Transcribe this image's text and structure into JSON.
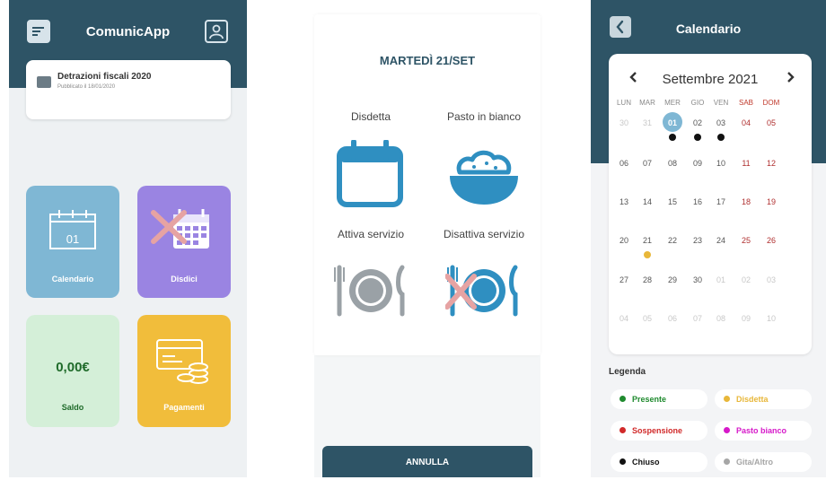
{
  "panel1": {
    "app_title": "ComunicApp",
    "news": {
      "title": "Detrazioni fiscali 2020",
      "subtitle": "Pubblicato il 18/01/2020"
    },
    "tiles": {
      "calendario": {
        "label": "Calendario",
        "day": "01"
      },
      "disdici": {
        "label": "Disdici"
      },
      "saldo": {
        "label": "Saldo",
        "amount": "0,00€"
      },
      "pagamenti": {
        "label": "Pagamenti"
      }
    },
    "colors": {
      "header": "#2e5466",
      "calendario": "#7fb7d4",
      "disdici": "#9a84e2",
      "saldo": "#d4efd8",
      "pagamenti": "#f1bd3b"
    }
  },
  "panel2": {
    "date_title": "MARTEDÌ 21/SET",
    "options": [
      {
        "label": "Disdetta",
        "icon": "calendar-icon"
      },
      {
        "label": "Pasto in bianco",
        "icon": "rice-bowl-icon"
      },
      {
        "label": "Attiva servizio",
        "icon": "plate-cutlery-icon"
      },
      {
        "label": "Disattiva servizio",
        "icon": "plate-cutlery-crossed-icon"
      }
    ],
    "cancel_label": "ANNULLA"
  },
  "panel3": {
    "title": "Calendario",
    "month": "Settembre 2021",
    "weekdays": [
      "LUN",
      "MAR",
      "MER",
      "GIO",
      "VEN",
      "SAB",
      "DOM"
    ],
    "weeks": [
      [
        "30",
        "31",
        "01",
        "02",
        "03",
        "04",
        "05"
      ],
      [
        "06",
        "07",
        "08",
        "09",
        "10",
        "11",
        "12"
      ],
      [
        "13",
        "14",
        "15",
        "16",
        "17",
        "18",
        "19"
      ],
      [
        "20",
        "21",
        "22",
        "23",
        "24",
        "25",
        "26"
      ],
      [
        "27",
        "28",
        "29",
        "30",
        "01",
        "02",
        "03"
      ],
      [
        "04",
        "05",
        "06",
        "07",
        "08",
        "09",
        "10"
      ]
    ],
    "selected_day": "01",
    "legend_title": "Legenda",
    "legend": [
      {
        "label": "Presente",
        "color": "#1f8a2e"
      },
      {
        "label": "Disdetta",
        "color": "#e8b73a"
      },
      {
        "label": "Sospensione",
        "color": "#d12a2a"
      },
      {
        "label": "Pasto bianco",
        "color": "#d619c9"
      },
      {
        "label": "Chiuso",
        "color": "#111111"
      },
      {
        "label": "Gita/Altro",
        "color": "#a6a6a6"
      }
    ]
  }
}
